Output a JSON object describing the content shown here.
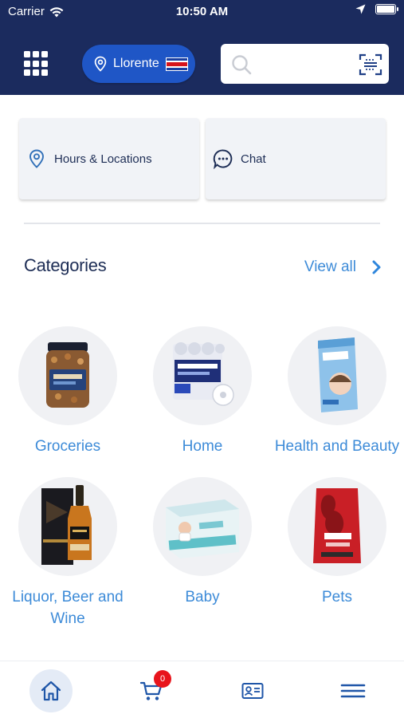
{
  "status_bar": {
    "carrier": "Carrier",
    "time": "10:50 AM"
  },
  "header": {
    "store_name": "Llorente",
    "search_placeholder": ""
  },
  "actions": {
    "hours_label": "Hours & Locations",
    "chat_label": "Chat"
  },
  "categories": {
    "title": "Categories",
    "view_all": "View all",
    "items": [
      {
        "label": "Groceries",
        "icon": "mixed-nuts-jar"
      },
      {
        "label": "Home",
        "icon": "bath-tissue-pack"
      },
      {
        "label": "Health and Beauty",
        "icon": "cleansing-towelettes-box"
      },
      {
        "label": "Liquor, Beer and Wine",
        "icon": "whisky-bottle"
      },
      {
        "label": "Baby",
        "icon": "baby-wipes-box"
      },
      {
        "label": "Pets",
        "icon": "dog-food-bag"
      }
    ]
  },
  "bottom_nav": {
    "cart_count": "0",
    "items": [
      "home",
      "cart",
      "membership-card",
      "menu"
    ]
  },
  "colors": {
    "header_bg": "#1b2b5e",
    "store_pill": "#1f56c6",
    "link": "#3d8bd8",
    "badge": "#e8141c"
  }
}
